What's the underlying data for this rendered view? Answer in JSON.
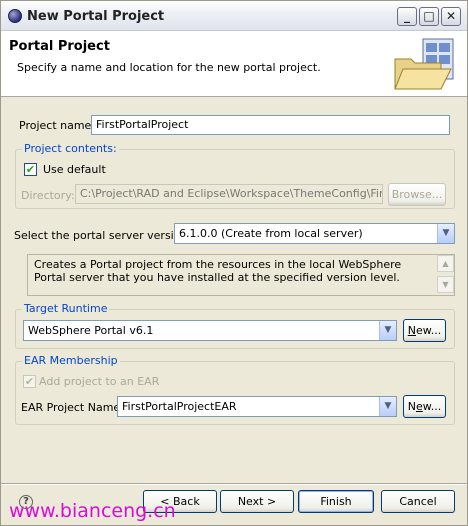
{
  "window": {
    "title": "New Portal Project"
  },
  "header": {
    "title": "Portal Project",
    "description": "Specify a name and location for the new portal project."
  },
  "project_name": {
    "label": "Project name:",
    "value": "FirstPortalProject"
  },
  "project_contents": {
    "legend": "Project contents:",
    "use_default_label": "Use default",
    "use_default_checked": true,
    "directory_label": "Directory:",
    "directory_value": "C:\\Project\\RAD and Eclipse\\Workspace\\ThemeConfig\\FirstPort",
    "browse_label": "Browse..."
  },
  "server_version": {
    "label": "Select the portal server version:",
    "selected": "6.1.0.0 (Create from local server)",
    "description": "Creates a Portal project from the resources in the local WebSphere Portal server that you have installed at the specified version level."
  },
  "target_runtime": {
    "legend": "Target Runtime",
    "selected": "WebSphere Portal v6.1",
    "new_label": "New..."
  },
  "ear_membership": {
    "legend": "EAR Membership",
    "add_to_ear_label": "Add project to an EAR",
    "add_to_ear_checked": true,
    "ear_name_label": "EAR Project Name:",
    "ear_name_selected": "FirstPortalProjectEAR",
    "new_label": "New..."
  },
  "footer": {
    "back_label": "< Back",
    "next_label": "Next >",
    "finish_label": "Finish",
    "cancel_label": "Cancel",
    "watermark": "www.bianceng.cn"
  },
  "icons": {
    "app": "eclipse-icon",
    "wizard": "portal-folder-icon",
    "help": "help-icon"
  }
}
